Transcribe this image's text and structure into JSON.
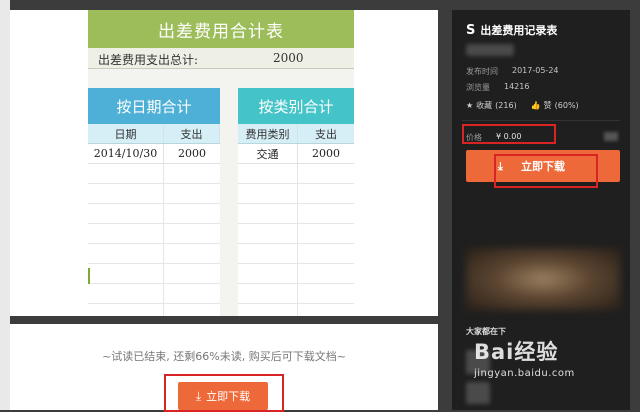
{
  "sheet": {
    "title": "出差费用合计表",
    "total_label": "出差费用支出总计:",
    "total_value": "2000",
    "by_date": {
      "title": "按日期合计",
      "columns": [
        "日期",
        "支出"
      ],
      "rows": [
        [
          "2014/10/30",
          "2000"
        ]
      ]
    },
    "by_category": {
      "title": "按类别合计",
      "columns": [
        "费用类别",
        "支出"
      ],
      "rows": [
        [
          "交通",
          "2000"
        ]
      ]
    }
  },
  "preview_footer": {
    "trial_text": "~试读已结束, 还剩66%未读, 购买后可下载文档~",
    "download_label": "立即下载"
  },
  "panel": {
    "title": "出差费用记录表",
    "publish_label": "发布时间",
    "publish_date": "2017-05-24",
    "views_label": "浏览量",
    "views_value": "14216",
    "favorite_label": "收藏",
    "favorite_count": "(216)",
    "like_label": "赞",
    "like_percent": "(60%)",
    "price_label": "价格",
    "price_value": "¥ 0.00",
    "download_label": "立即下载",
    "section_title": "大家都在下"
  },
  "watermark": {
    "brand": "Bai经验",
    "url": "jingyan.baidu.com"
  },
  "colors": {
    "title_green": "#9cbd5a",
    "date_blue": "#4eb0d6",
    "category_teal": "#44c4c8",
    "accent_orange": "#ee6939",
    "highlight_red": "#d82424",
    "panel_bg": "#1f1f1f"
  }
}
